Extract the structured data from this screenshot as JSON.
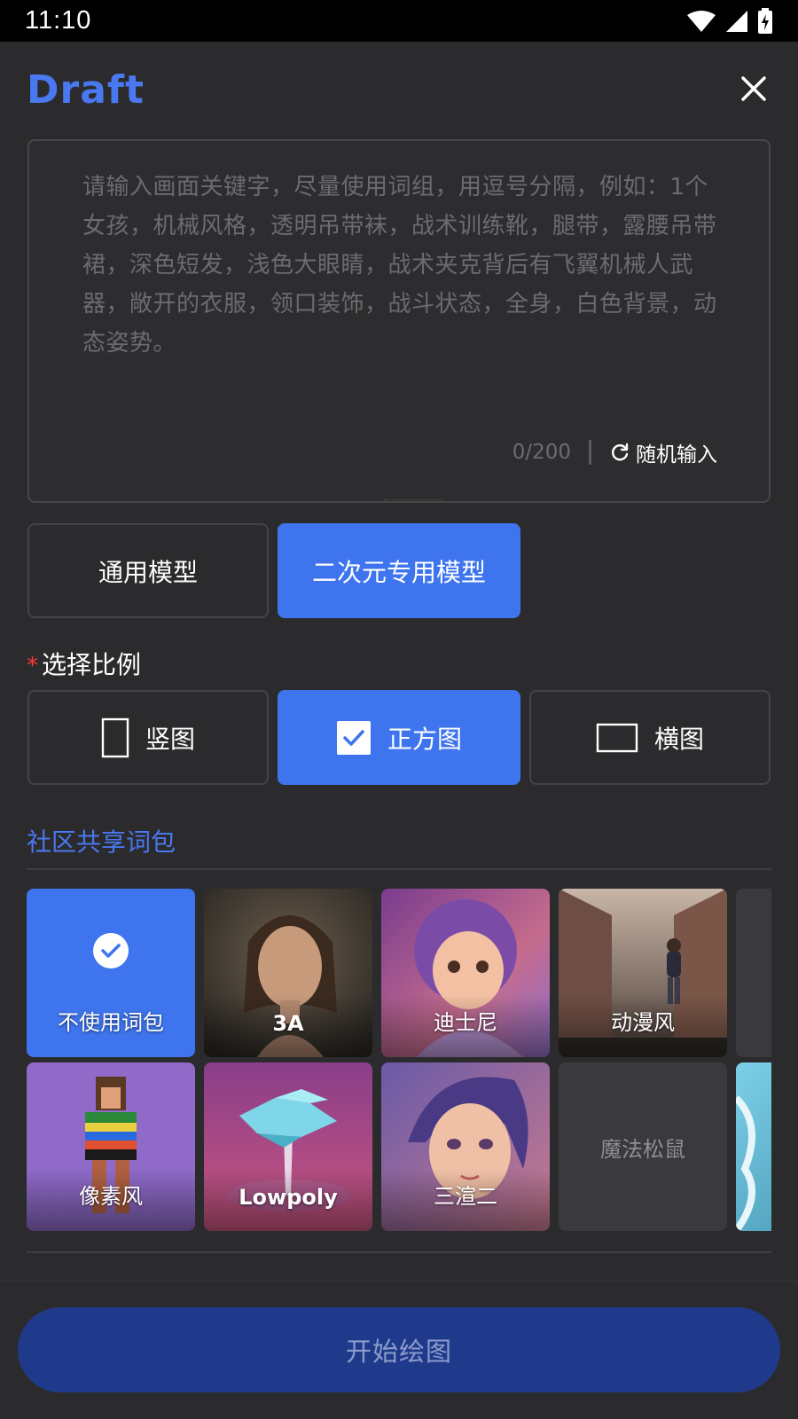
{
  "status_bar": {
    "time": "11:10",
    "icons": [
      "wifi-icon",
      "cellular-signal-icon",
      "battery-charging-icon"
    ]
  },
  "header": {
    "logo_text": "Draft",
    "close_icon": "close-icon"
  },
  "prompt": {
    "placeholder": "请输入画面关键字，尽量使用词组，用逗号分隔，例如：1个女孩，机械风格，透明吊带袜，战术训练靴，腿带，露腰吊带裙，深色短发，浅色大眼睛，战术夹克背后有飞翼机械人武器，敞开的衣服，领口装饰，战斗状态，全身，白色背景，动态姿势。",
    "char_count": "0/200",
    "random_label": "随机输入"
  },
  "model_tabs": [
    {
      "label": "通用模型",
      "selected": false
    },
    {
      "label": "二次元专用模型",
      "selected": true
    }
  ],
  "ratio": {
    "required_mark": "*",
    "label": "选择比例",
    "options": [
      {
        "label": "竖图",
        "icon": "portrait-frame-icon",
        "selected": false
      },
      {
        "label": "正方图",
        "icon": "checkbox-checked-icon",
        "selected": true
      },
      {
        "label": "横图",
        "icon": "landscape-frame-icon",
        "selected": false
      }
    ]
  },
  "community": {
    "title": "社区共享词包",
    "presets": [
      {
        "label": "不使用词包",
        "selected": true,
        "icon": "check-circle-icon"
      },
      {
        "label": "3A",
        "selected": false
      },
      {
        "label": "迪士尼",
        "selected": false
      },
      {
        "label": "动漫风",
        "selected": false
      },
      {
        "label": "像素风",
        "selected": false
      },
      {
        "label": "Lowpoly",
        "selected": false
      },
      {
        "label": "三渲二",
        "selected": false
      },
      {
        "label": "魔法松鼠",
        "selected": false
      }
    ]
  },
  "action": {
    "start_label": "开始绘图"
  },
  "colors": {
    "accent": "#3e74ed",
    "logo": "#4a78f0",
    "background": "#2b2b2d",
    "start_button": "#1f3a8a",
    "required": "#ff3b30"
  }
}
